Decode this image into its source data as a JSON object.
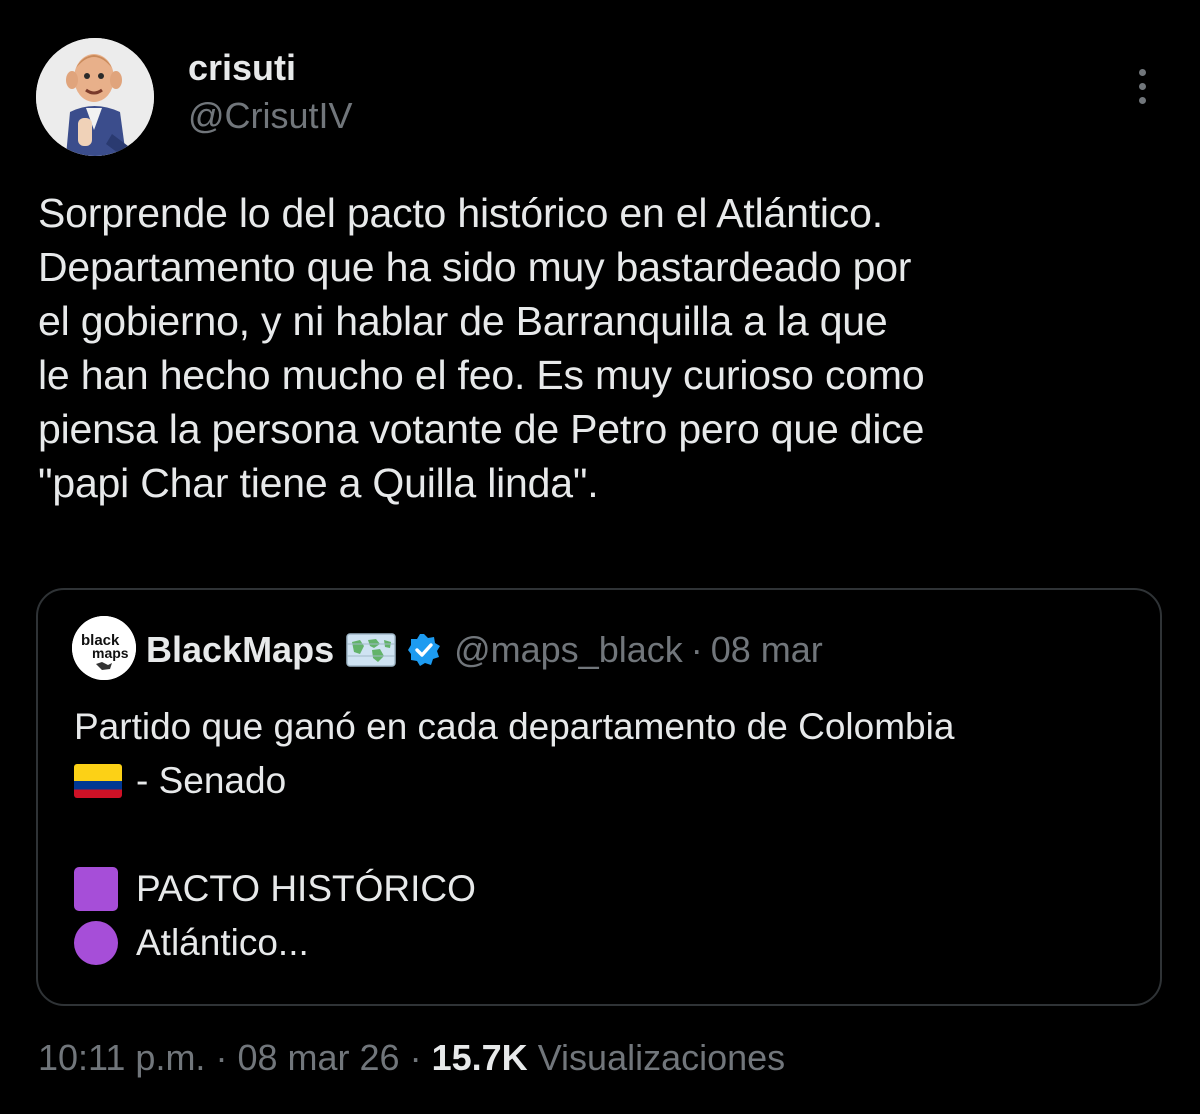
{
  "author": {
    "display_name": "crisuti",
    "handle": "@CrisutIV",
    "avatar_icon": "cartoon-portrait-avatar"
  },
  "menu": {
    "icon": "more-vertical-icon"
  },
  "tweet": {
    "text": "Sorprende lo del pacto histórico en el Atlántico.\nDepartamento que ha sido muy bastardeado por\nel gobierno, y ni hablar de Barranquilla a la que\nle han hecho mucho el feo. Es muy curioso como\npiensa la persona votante de Petro pero que dice\n\"papi Char tiene a Quilla linda\"."
  },
  "quote": {
    "avatar_text_line1": "black",
    "avatar_text_line2": "maps",
    "display_name": "BlackMaps",
    "handle": "@maps_black",
    "separator": "·",
    "date": "08 mar",
    "map_icon": "world-map-icon",
    "verified_icon": "verified-badge-icon",
    "line1": "Partido que ganó en cada departamento de Colombia",
    "line2": "- Senado",
    "line3": "PACTO HISTÓRICO",
    "line4": "Atlántico...",
    "purple": "#a64ed8"
  },
  "footer": {
    "time": "10:11 p.m.",
    "separator1": "·",
    "date": "08 mar 26",
    "separator2": "·",
    "views_count": "15.7K",
    "views_label": "Visualizaciones"
  },
  "colors": {
    "background": "#000000",
    "text_primary": "#e7e9ea",
    "text_secondary": "#71767b",
    "border": "#2f3336",
    "verified_blue": "#1d9bf0"
  }
}
